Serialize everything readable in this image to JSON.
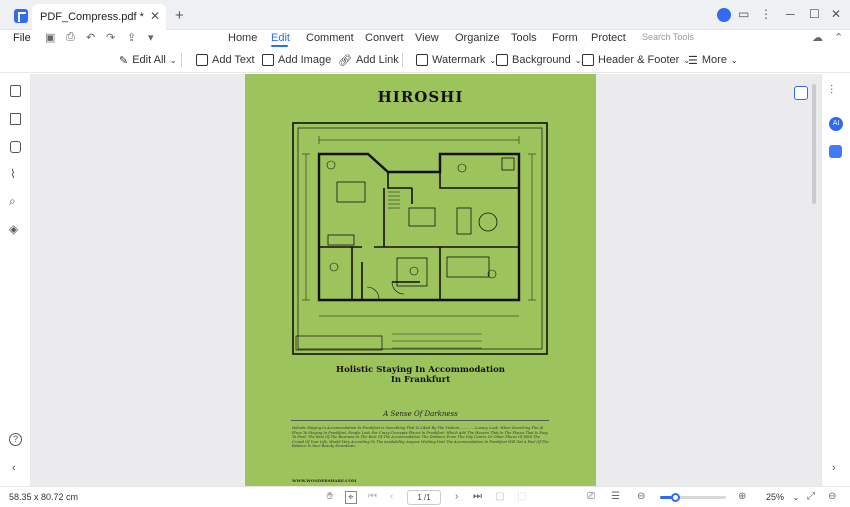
{
  "titlebar": {
    "tab_title": "PDF_Compress.pdf *",
    "close_glyph": "✕",
    "add_glyph": "+",
    "window_controls": [
      "─",
      "☐",
      "✕"
    ]
  },
  "menubar": {
    "file": "File",
    "tabs": [
      "Home",
      "Edit",
      "Comment",
      "Convert",
      "View",
      "Organize",
      "Tools",
      "Form",
      "Protect"
    ],
    "active_tab": "Edit",
    "search_placeholder": "Search Tools"
  },
  "ribbon": {
    "edit_all": "Edit All",
    "add_text": "Add Text",
    "add_image": "Add Image",
    "add_link": "Add Link",
    "watermark": "Watermark",
    "background": "Background",
    "header_footer": "Header & Footer",
    "more": "More"
  },
  "document": {
    "title": "HIROSHI",
    "heading_line1": "Holistic Staying In Accommodation",
    "heading_line2": "In Frankfurt",
    "subheading": "A Sense Of Darkness",
    "paragraph": "Holistic Staying In Accommodation In Frankfurt Is Something That Is Liked By The Visitors..............Luxury Look. When Searching The Al Place To Staying In Frankfurt, People Look For Crazy Concepts Places In Frankfurt, Which Add The Heaven That In The Places That Is Easy To Find. The Best Of The Business In The Best Of The Accommodation The Distance From The City Centre Or Other Places Of With The Crowd Of Your Life, Would Very According To The Availability, Anyone Wishing Visit The Accommodation In Frankfurt Will Get A Feel Of The Balance Is Your Beauty Downtown.",
    "footer": "WWW.WONDERSHARE.COM"
  },
  "statusbar": {
    "dimensions": "58.35 x 80.72 cm",
    "page_indicator": "1 /1",
    "zoom": "25%",
    "zoom_fraction": 0.22
  },
  "colors": {
    "accent": "#2f6bf3",
    "page_bg": "#9dc35c",
    "canvas_bg": "#ebebed"
  }
}
